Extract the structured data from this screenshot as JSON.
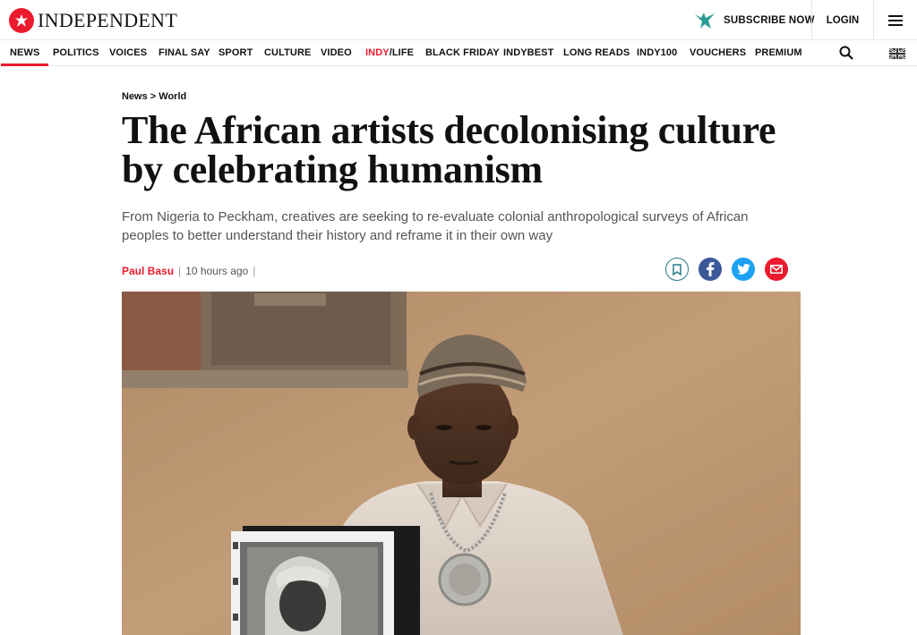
{
  "header": {
    "logo_text": "INDEPENDENT",
    "subscribe_label": "SUBSCRIBE NOW",
    "login_label": "LOGIN"
  },
  "nav": {
    "items": [
      {
        "label": "NEWS",
        "active": true
      },
      {
        "label": "POLITICS"
      },
      {
        "label": "VOICES"
      },
      {
        "label": "FINAL SAY"
      },
      {
        "label": "SPORT"
      },
      {
        "label": "CULTURE"
      },
      {
        "label": "VIDEO"
      },
      {
        "label_prefix": "INDY",
        "label_suffix": "/LIFE"
      },
      {
        "label": "BLACK FRIDAY"
      },
      {
        "label": "INDYBEST"
      },
      {
        "label": "LONG READS"
      },
      {
        "label": "INDY100"
      },
      {
        "label": "VOUCHERS"
      },
      {
        "label": "PREMIUM"
      }
    ]
  },
  "article": {
    "breadcrumb": "News > World",
    "headline": "The African artists decolonising culture by celebrating humanism",
    "standfirst": "From Nigeria to Peckham, creatives are seeking to re-evaluate colonial anthropological surveys of African peoples to better understand their history and reframe it in their own way",
    "author": "Paul Basu",
    "timestamp": "10 hours ago"
  },
  "share": {
    "icons": [
      "bookmark-icon",
      "facebook-icon",
      "twitter-icon",
      "email-icon"
    ]
  },
  "colors": {
    "brand_red": "#ec1a2e",
    "facebook": "#3b5998",
    "twitter": "#1da1f2"
  }
}
